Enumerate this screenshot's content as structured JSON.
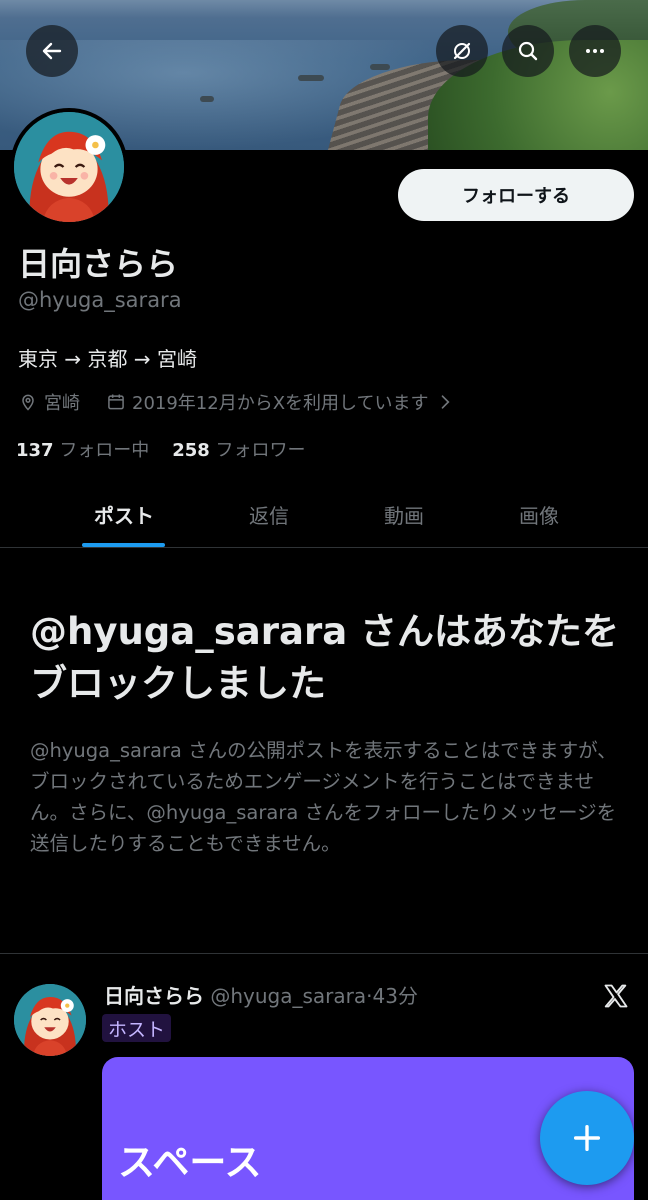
{
  "profile": {
    "display_name": "日向さらら",
    "handle": "@hyuga_sarara",
    "bio": "東京 → 京都 → 宮崎",
    "location": "宮崎",
    "joined": "2019年12月からXを利用しています",
    "following_count": "137",
    "following_label": "フォロー中",
    "followers_count": "258",
    "followers_label": "フォロワー",
    "follow_button": "フォローする"
  },
  "header": {
    "icons": [
      "back-arrow-icon",
      "grok-icon",
      "search-icon",
      "more-icon"
    ]
  },
  "tabs": [
    {
      "label": "ポスト",
      "active": true
    },
    {
      "label": "返信",
      "active": false
    },
    {
      "label": "動画",
      "active": false
    },
    {
      "label": "画像",
      "active": false
    }
  ],
  "blocked_notice": {
    "title": "@hyuga_sarara さんはあなたをブロックしました",
    "description": "@hyuga_sarara さんの公開ポストを表示することはできますが、ブロックされているためエンゲージメントを行うことはできません。さらに、@hyuga_sarara さんをフォローしたりメッセージを送信したりすることもできません。"
  },
  "post": {
    "author_name": "日向さらら",
    "author_handle": "@hyuga_sarara",
    "separator": "·",
    "time": "43分",
    "badge": "ホスト",
    "card_title": "スペース"
  },
  "colors": {
    "accent": "#1d9bf0",
    "space_card": "#7856ff",
    "background": "#000000",
    "muted_text": "#71767b"
  }
}
